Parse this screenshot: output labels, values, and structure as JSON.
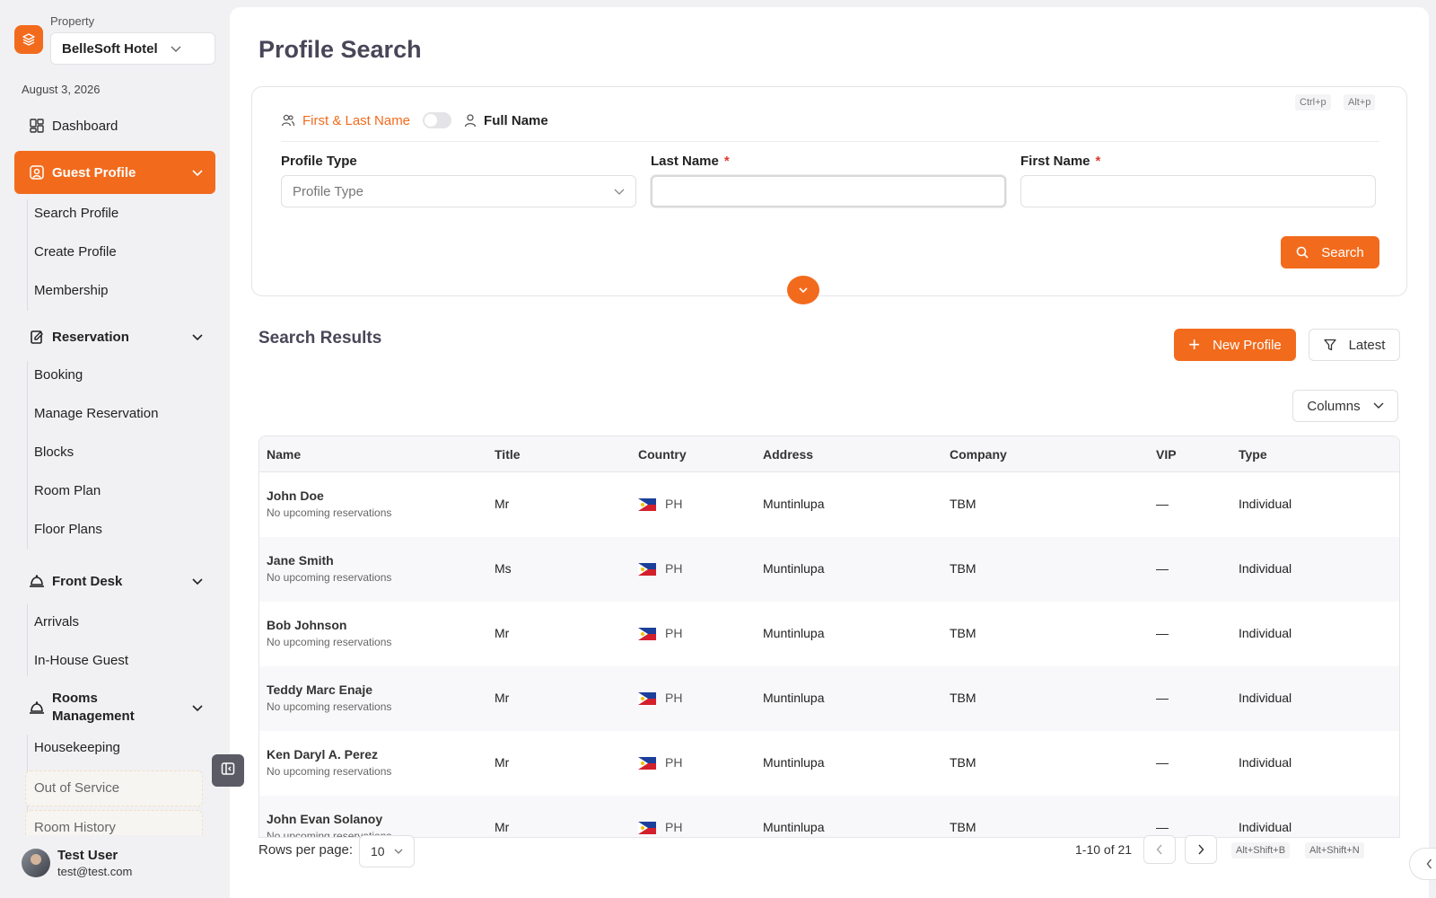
{
  "sidebar": {
    "property_label": "Property",
    "property_value": "BelleSoft Hotel",
    "date": "August 3, 2026",
    "dashboard": "Dashboard",
    "guest_profile": {
      "label": "Guest Profile",
      "items": [
        "Search Profile",
        "Create Profile",
        "Membership"
      ]
    },
    "reservation": {
      "label": "Reservation",
      "items": [
        "Booking",
        "Manage Reservation",
        "Blocks",
        "Room Plan",
        "Floor Plans"
      ]
    },
    "front_desk": {
      "label": "Front Desk",
      "items": [
        "Arrivals",
        "In-House Guest"
      ]
    },
    "rooms_management": {
      "label_line1": "Rooms",
      "label_line2": "Management",
      "items": [
        "Housekeeping",
        "Out of Service",
        "Room History"
      ]
    },
    "user": {
      "name": "Test User",
      "email": "test@test.com"
    }
  },
  "main": {
    "title": "Profile Search",
    "search": {
      "shortcut1": "Ctrl+p",
      "shortcut2": "Alt+p",
      "mode_a": "First & Last Name",
      "mode_b": "Full Name",
      "profile_type_label": "Profile Type",
      "profile_type_placeholder": "Profile Type",
      "last_name_label": "Last Name",
      "first_name_label": "First Name",
      "required_mark": "*",
      "last_name_value": "",
      "first_name_value": "",
      "search_button": "Search"
    },
    "results": {
      "title": "Search Results",
      "new_profile": "New Profile",
      "latest": "Latest",
      "columns": "Columns",
      "headers": [
        "Name",
        "Title",
        "Country",
        "Address",
        "Company",
        "VIP",
        "Type"
      ],
      "rows": [
        {
          "name": "John Doe",
          "sub": "No upcoming reservations",
          "title": "Mr",
          "country": "PH",
          "address": "Muntinlupa",
          "company": "TBM",
          "vip": "—",
          "type": "Individual"
        },
        {
          "name": "Jane Smith",
          "sub": "No upcoming reservations",
          "title": "Ms",
          "country": "PH",
          "address": "Muntinlupa",
          "company": "TBM",
          "vip": "—",
          "type": "Individual"
        },
        {
          "name": "Bob Johnson",
          "sub": "No upcoming reservations",
          "title": "Mr",
          "country": "PH",
          "address": "Muntinlupa",
          "company": "TBM",
          "vip": "—",
          "type": "Individual"
        },
        {
          "name": "Teddy Marc Enaje",
          "sub": "No upcoming reservations",
          "title": "Mr",
          "country": "PH",
          "address": "Muntinlupa",
          "company": "TBM",
          "vip": "—",
          "type": "Individual"
        },
        {
          "name": "Ken Daryl A. Perez",
          "sub": "No upcoming reservations",
          "title": "Mr",
          "country": "PH",
          "address": "Muntinlupa",
          "company": "TBM",
          "vip": "—",
          "type": "Individual"
        },
        {
          "name": "John Evan Solanoy",
          "sub": "No upcoming reservations",
          "title": "Mr",
          "country": "PH",
          "address": "Muntinlupa",
          "company": "TBM",
          "vip": "—",
          "type": "Individual"
        }
      ]
    },
    "footer": {
      "rows_label": "Rows per page:",
      "rows_value": "10",
      "range": "1-10 of 21",
      "shortcut_prev": "Alt+Shift+B",
      "shortcut_next": "Alt+Shift+N"
    }
  },
  "colors": {
    "accent": "#f26b1d",
    "title": "#4a4658",
    "required": "#e23c2c"
  }
}
